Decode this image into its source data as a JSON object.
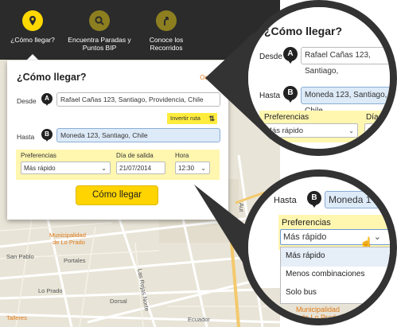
{
  "nav": {
    "items": [
      {
        "label": "¿Cómo llegar?",
        "icon": "location-pin-icon"
      },
      {
        "label": "Encuentra Paradas y Puntos BIP",
        "icon": "search-icon"
      },
      {
        "label": "Conoce los Recorridos",
        "icon": "route-icon"
      }
    ]
  },
  "panel": {
    "title": "¿Cómo llegar?",
    "hide_label": "Ocultar",
    "from_label": "Desde",
    "from_pin": "A",
    "from_value": "Rafael Cañas 123, Santiago, Providencia, Chile",
    "to_label": "Hasta",
    "to_pin": "B",
    "to_value": "Moneda 123, Santiago, Chile",
    "invert_label": "Invertir ruta",
    "invert_arrows": "⇅",
    "preferences_label": "Preferencias",
    "preferences_value": "Más rápido",
    "date_label": "Día de salida",
    "date_value": "21/07/2014",
    "time_label": "Hora",
    "time_value": "12:30",
    "go_button": "Cómo llegar"
  },
  "map_labels": {
    "municipalidad": "Municipalidad",
    "de_lo_prado": "de Lo Prado",
    "san_pablo": "San Pablo",
    "portales": "Portales",
    "lo_prado": "Lo Prado",
    "dorsal": "Dorsal",
    "las_rejas_norte": "Las Rejas Norte",
    "talleres": "Talleres",
    "ecuador": "Ecuador",
    "aut": "Aut"
  },
  "zoom1": {
    "title": "¿Cómo llegar?",
    "from_label": "Desde",
    "from_pin": "A",
    "from_value": "Rafael Cañas 123, Santiago,",
    "to_label": "Hasta",
    "to_pin": "B",
    "to_value": "Moneda 123, Santiago, Chile",
    "preferences_label": "Preferencias",
    "preferences_value": "Más rápido",
    "date_label_partial": "Día",
    "date_value_partial": "21/"
  },
  "zoom2": {
    "to_label": "Hasta",
    "to_pin": "B",
    "to_value": "Moneda 1",
    "preferences_label": "Preferencias",
    "preferences_value": "Más rápido",
    "options": [
      "Más rápido",
      "Menos combinaciones",
      "Solo bus"
    ],
    "map_label_1": "Municipalidad",
    "map_label_2": "de Lo Prado"
  },
  "colors": {
    "accent_yellow": "#ffd400",
    "nav_bg": "#2b2b2b",
    "link_orange": "#e9811e",
    "input_blue": "#ddeaf8"
  }
}
